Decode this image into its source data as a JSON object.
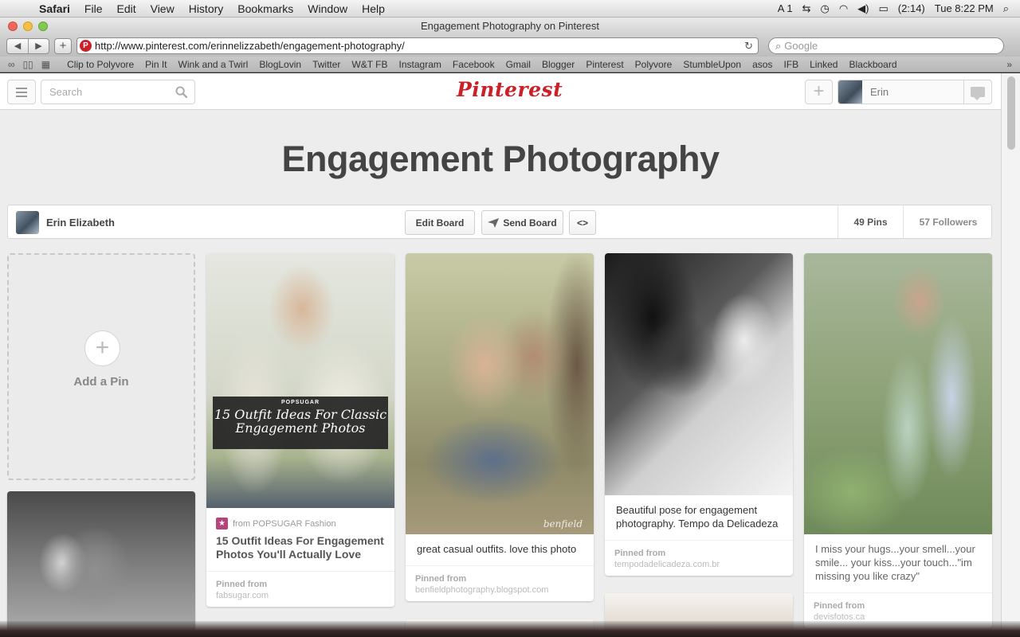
{
  "menubar": {
    "apple": "",
    "items": [
      "Safari",
      "File",
      "Edit",
      "View",
      "History",
      "Bookmarks",
      "Window",
      "Help"
    ],
    "battery": "(2:14)",
    "clock": "Tue 8:22 PM",
    "input_indicator": "1"
  },
  "window": {
    "title": "Engagement Photography on Pinterest"
  },
  "toolbar": {
    "url": "http://www.pinterest.com/erinnelizzabeth/engagement-photography/",
    "search_placeholder": "Google"
  },
  "bookmarks": [
    "Clip to Polyvore",
    "Pin It",
    "Wink and a Twirl",
    "BlogLovin",
    "Twitter",
    "W&T FB",
    "Instagram",
    "Facebook",
    "Gmail",
    "Blogger",
    "Pinterest",
    "Polyvore",
    "StumbleUpon",
    "asos",
    "IFB",
    "Linked",
    "Blackboard"
  ],
  "pinterest": {
    "search_placeholder": "Search",
    "logo": "Pinterest",
    "user_name": "Erin"
  },
  "board": {
    "title": "Engagement Photography",
    "owner": "Erin Elizabeth",
    "edit_label": "Edit Board",
    "send_label": "Send Board",
    "embed_label": "<>",
    "pins_count": "49 Pins",
    "followers_count": "57 Followers"
  },
  "add_pin": {
    "label": "Add a Pin",
    "plus": "+"
  },
  "pins": [
    {
      "overlay_brand": "POPSUGAR",
      "overlay_text": "15 Outfit Ideas For Classic Engagement Photos",
      "source_text": "from POPSUGAR Fashion",
      "title": "15 Outfit Ideas For Engagement Photos You'll Actually Love",
      "pinned_label": "Pinned from",
      "pinned_src": "fabsugar.com"
    },
    {
      "description": "great casual outfits. love this photo",
      "watermark": "benfield",
      "pinned_label": "Pinned from",
      "pinned_src": "benfieldphotography.blogspot.com"
    },
    {
      "description": "Beautiful pose for engagement photography. Tempo da Delicadeza",
      "pinned_label": "Pinned from",
      "pinned_src": "tempodadelicadeza.com.br"
    },
    {
      "description": "I miss your hugs...your smell...your smile... your kiss...your touch...\"im missing you like crazy\"",
      "pinned_label": "Pinned from",
      "pinned_src": "devisfotos.ca"
    }
  ]
}
